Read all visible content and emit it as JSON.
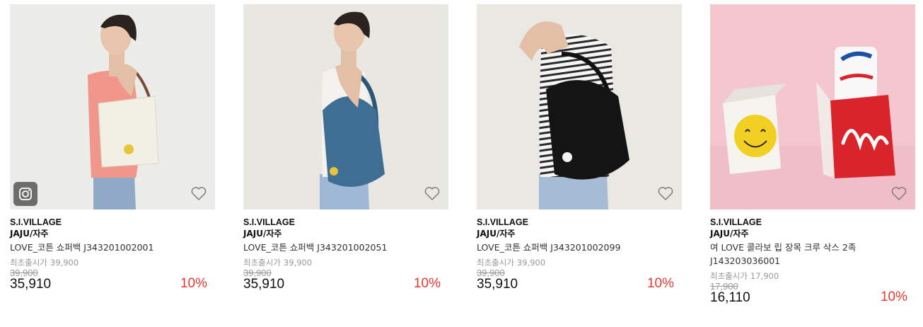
{
  "products": [
    {
      "brand": "S.I.VILLAGE",
      "sub_brand": "JAJU/자주",
      "name": "LOVE_코튼 쇼퍼백 J343201002001",
      "orig_label": "최초출시가",
      "orig_price": "39,900",
      "list_price": "39,900",
      "sale_price": "35,910",
      "discount": "10%",
      "heart_icon": "heart-outline-icon",
      "instagram_icon": "instagram-icon",
      "bag_color": "#ece9df",
      "shirt_color": "#f1968a"
    },
    {
      "brand": "S.I.VILLAGE",
      "sub_brand": "JAJU/자주",
      "name": "LOVE_코튼 쇼퍼백 J343201002051",
      "orig_label": "최초출시가",
      "orig_price": "39,900",
      "list_price": "39,900",
      "sale_price": "35,910",
      "discount": "10%",
      "heart_icon": "heart-outline-icon",
      "bag_color": "#3e6e93",
      "shirt_color": "#f4f2ee"
    },
    {
      "brand": "S.I.VILLAGE",
      "sub_brand": "JAJU/자주",
      "name": "LOVE_코튼 쇼퍼백 J343201002099",
      "orig_label": "최초출시가",
      "orig_price": "39,900",
      "list_price": "39,900",
      "sale_price": "35,910",
      "discount": "10%",
      "heart_icon": "heart-outline-icon",
      "bag_color": "#141414",
      "shirt_color": "striped"
    },
    {
      "brand": "S.I.VILLAGE",
      "sub_brand": "JAJU/자주",
      "name": "여 LOVE 콜라보 립 장목 크루 삭스 2족 J143203036001",
      "orig_label": "최초출시가",
      "orig_price": "17,900",
      "list_price": "17,900",
      "sale_price": "16,110",
      "discount": "10%",
      "heart_icon": "heart-outline-icon",
      "bg_color": "#f4c7d0",
      "box_color": "#d9242b"
    }
  ],
  "colors": {
    "discount": "#e43a34",
    "muted": "#999999"
  }
}
